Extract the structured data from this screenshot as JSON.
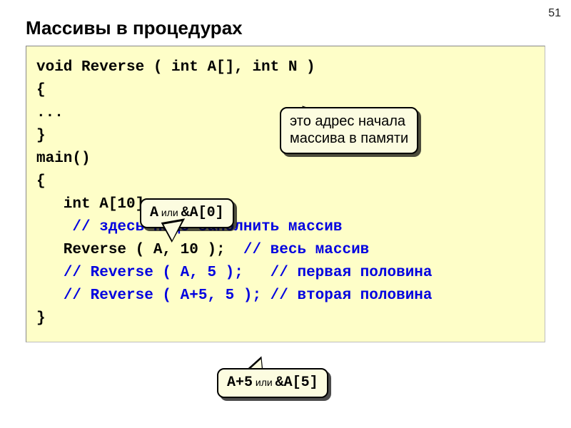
{
  "pageNumber": "51",
  "title": "Массивы в процедурах",
  "code": {
    "l1": "void Reverse ( int A[], int N )",
    "l2": "{",
    "l3": "...",
    "l4": "}",
    "l5": "main()",
    "l6": "{",
    "l7": "   int A[10];",
    "l8a": "    ",
    "l8b": "// здесь надо заполнить массив",
    "l9a": "   Reverse ( A, 10 );  ",
    "l9b": "// весь массив",
    "l10a": "   ",
    "l10b": "// Reverse ( A, 5 );   // первая половина",
    "l11a": "   ",
    "l11b": "// Reverse ( A+5, 5 ); // вторая половина",
    "l12": "}"
  },
  "callouts": {
    "c1_line1": "это адрес начала",
    "c1_line2": "массива в памяти",
    "c2_pre": "A",
    "c2_mid": " или ",
    "c2_post": "&A[0]",
    "c3_pre": "A+5",
    "c3_mid": " или ",
    "c3_post": "&A[5]"
  }
}
